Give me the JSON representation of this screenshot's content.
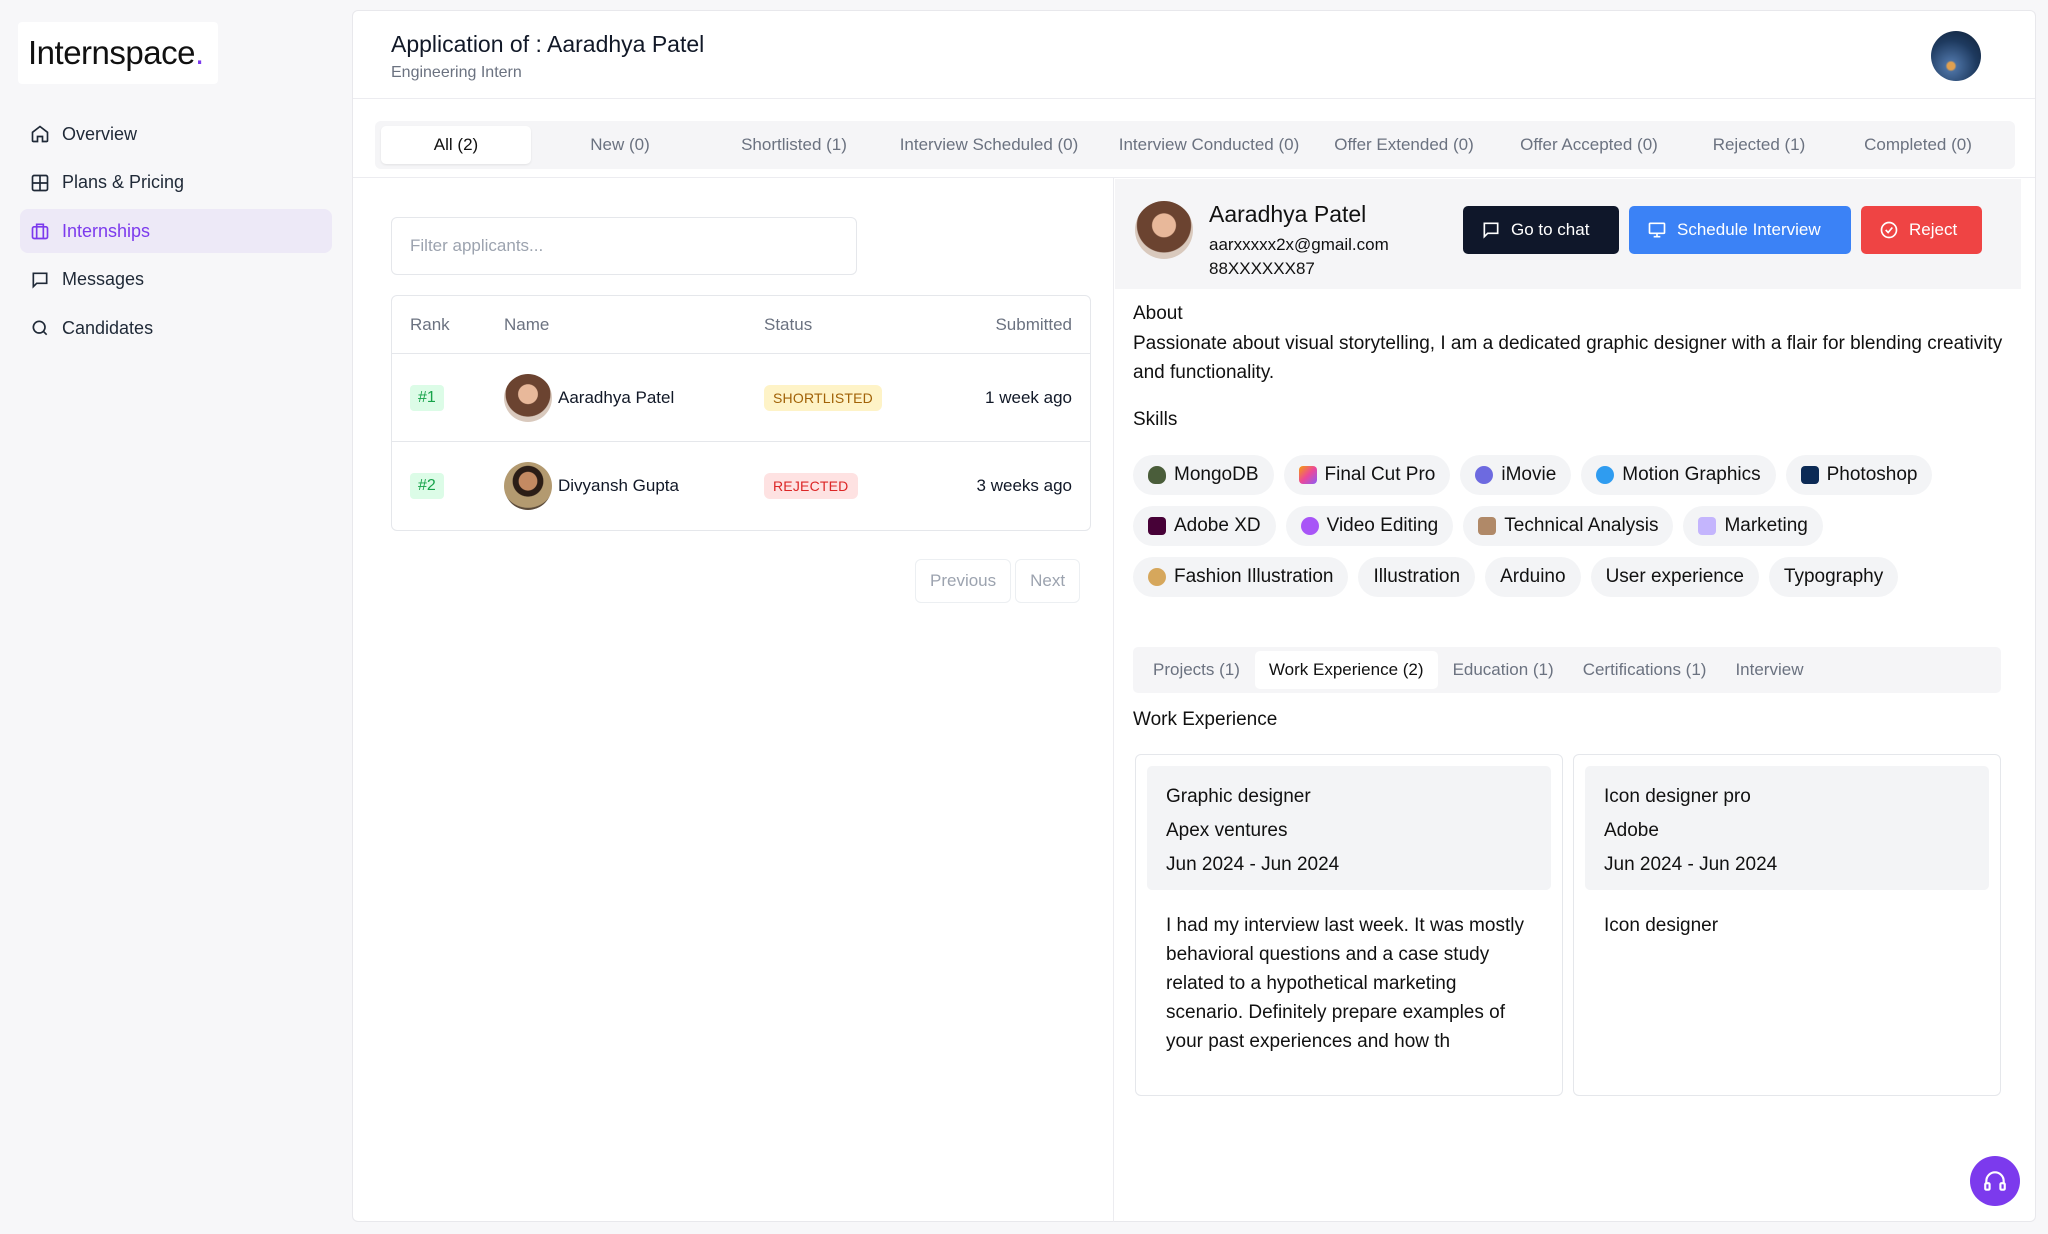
{
  "brand": {
    "name": "Internspace",
    "dot": ".",
    "accent": "#7c3aed"
  },
  "sidebar": {
    "items": [
      {
        "label": "Overview",
        "icon": "home-icon"
      },
      {
        "label": "Plans & Pricing",
        "icon": "grid-icon"
      },
      {
        "label": "Internships",
        "icon": "briefcase-icon",
        "active": true
      },
      {
        "label": "Messages",
        "icon": "message-icon"
      },
      {
        "label": "Candidates",
        "icon": "search-icon"
      }
    ]
  },
  "header": {
    "title": "Application of : Aaradhya Patel",
    "subtitle": "Engineering Intern"
  },
  "tabs": [
    "All (2)",
    "New (0)",
    "Shortlisted (1)",
    "Interview Scheduled (0)",
    "Interview Conducted (0)",
    "Offer Extended (0)",
    "Offer Accepted (0)",
    "Rejected (1)",
    "Completed (0)"
  ],
  "filter": {
    "placeholder": "Filter applicants..."
  },
  "table": {
    "headers": {
      "rank": "Rank",
      "name": "Name",
      "status": "Status",
      "submitted": "Submitted"
    },
    "rows": [
      {
        "rank": "#1",
        "name": "Aaradhya Patel",
        "status": "SHORTLISTED",
        "submitted": "1 week ago"
      },
      {
        "rank": "#2",
        "name": "Divyansh Gupta",
        "status": "REJECTED",
        "submitted": "3 weeks ago"
      }
    ]
  },
  "pager": {
    "previous": "Previous",
    "next": "Next"
  },
  "detail": {
    "name": "Aaradhya Patel",
    "email": "aarxxxxx2x@gmail.com",
    "phone": "88XXXXXX87",
    "buttons": {
      "chat": "Go to chat",
      "schedule": "Schedule Interview",
      "reject": "Reject"
    },
    "about_heading": "About",
    "about": "Passionate about visual storytelling, I am a dedicated graphic designer with a flair for blending creativity and functionality.",
    "skills_heading": "Skills",
    "skills": [
      "MongoDB",
      "Final Cut Pro",
      "iMovie",
      "Motion Graphics",
      "Photoshop",
      "Adobe XD",
      "Video Editing",
      "Technical Analysis",
      "Marketing",
      "Fashion Illustration",
      "Illustration",
      "Arduino",
      "User experience",
      "Typography"
    ],
    "sub_tabs": [
      "Projects (1)",
      "Work Experience (2)",
      "Education (1)",
      "Certifications (1)",
      "Interview"
    ],
    "work_heading": "Work Experience",
    "work": [
      {
        "title": "Graphic designer",
        "company": "Apex ventures",
        "dates": "Jun 2024 - Jun 2024",
        "description": "I had my interview last week. It was mostly behavioral questions and a case study related to a hypothetical marketing scenario. Definitely prepare examples of your past experiences and how th"
      },
      {
        "title": "Icon designer pro",
        "company": "Adobe",
        "dates": "Jun 2024 - Jun 2024",
        "description": "Icon designer"
      }
    ]
  }
}
